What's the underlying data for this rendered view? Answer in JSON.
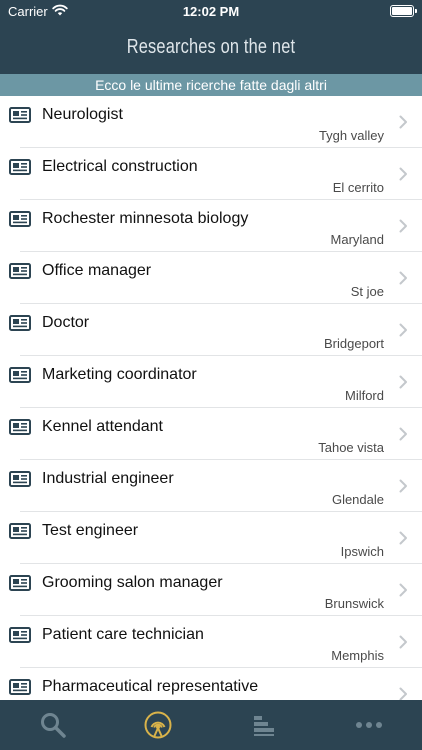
{
  "status_bar": {
    "carrier": "Carrier",
    "time": "12:02 PM"
  },
  "nav": {
    "title": "Researches on the net"
  },
  "banner": {
    "text": "Ecco le ultime ricerche fatte dagli altri"
  },
  "list": {
    "row_icon": "newspaper-icon",
    "items": [
      {
        "title": "Neurologist",
        "location": "Tygh valley"
      },
      {
        "title": "Electrical construction",
        "location": "El cerrito"
      },
      {
        "title": "Rochester minnesota biology",
        "location": "Maryland"
      },
      {
        "title": "Office manager",
        "location": "St joe"
      },
      {
        "title": "Doctor",
        "location": "Bridgeport"
      },
      {
        "title": "Marketing coordinator",
        "location": "Milford"
      },
      {
        "title": "Kennel attendant",
        "location": "Tahoe vista"
      },
      {
        "title": "Industrial engineer",
        "location": "Glendale"
      },
      {
        "title": "Test engineer",
        "location": "Ipswich"
      },
      {
        "title": "Grooming salon manager",
        "location": "Brunswick"
      },
      {
        "title": "Patient care technician",
        "location": "Memphis"
      },
      {
        "title": "Pharmaceutical representative",
        "location": ""
      }
    ]
  },
  "tab_bar": {
    "tabs": [
      {
        "icon": "search-icon",
        "active": false
      },
      {
        "icon": "broadcast-icon",
        "active": true
      },
      {
        "icon": "bar-chart-icon",
        "active": false
      },
      {
        "icon": "more-icon",
        "active": false
      }
    ]
  },
  "colors": {
    "nav_bg": "#2c4452",
    "banner_bg": "#6c97a4",
    "active_tab": "#d9b34a",
    "inactive_tab": "#6f8591",
    "icon_color": "#2c4452"
  }
}
